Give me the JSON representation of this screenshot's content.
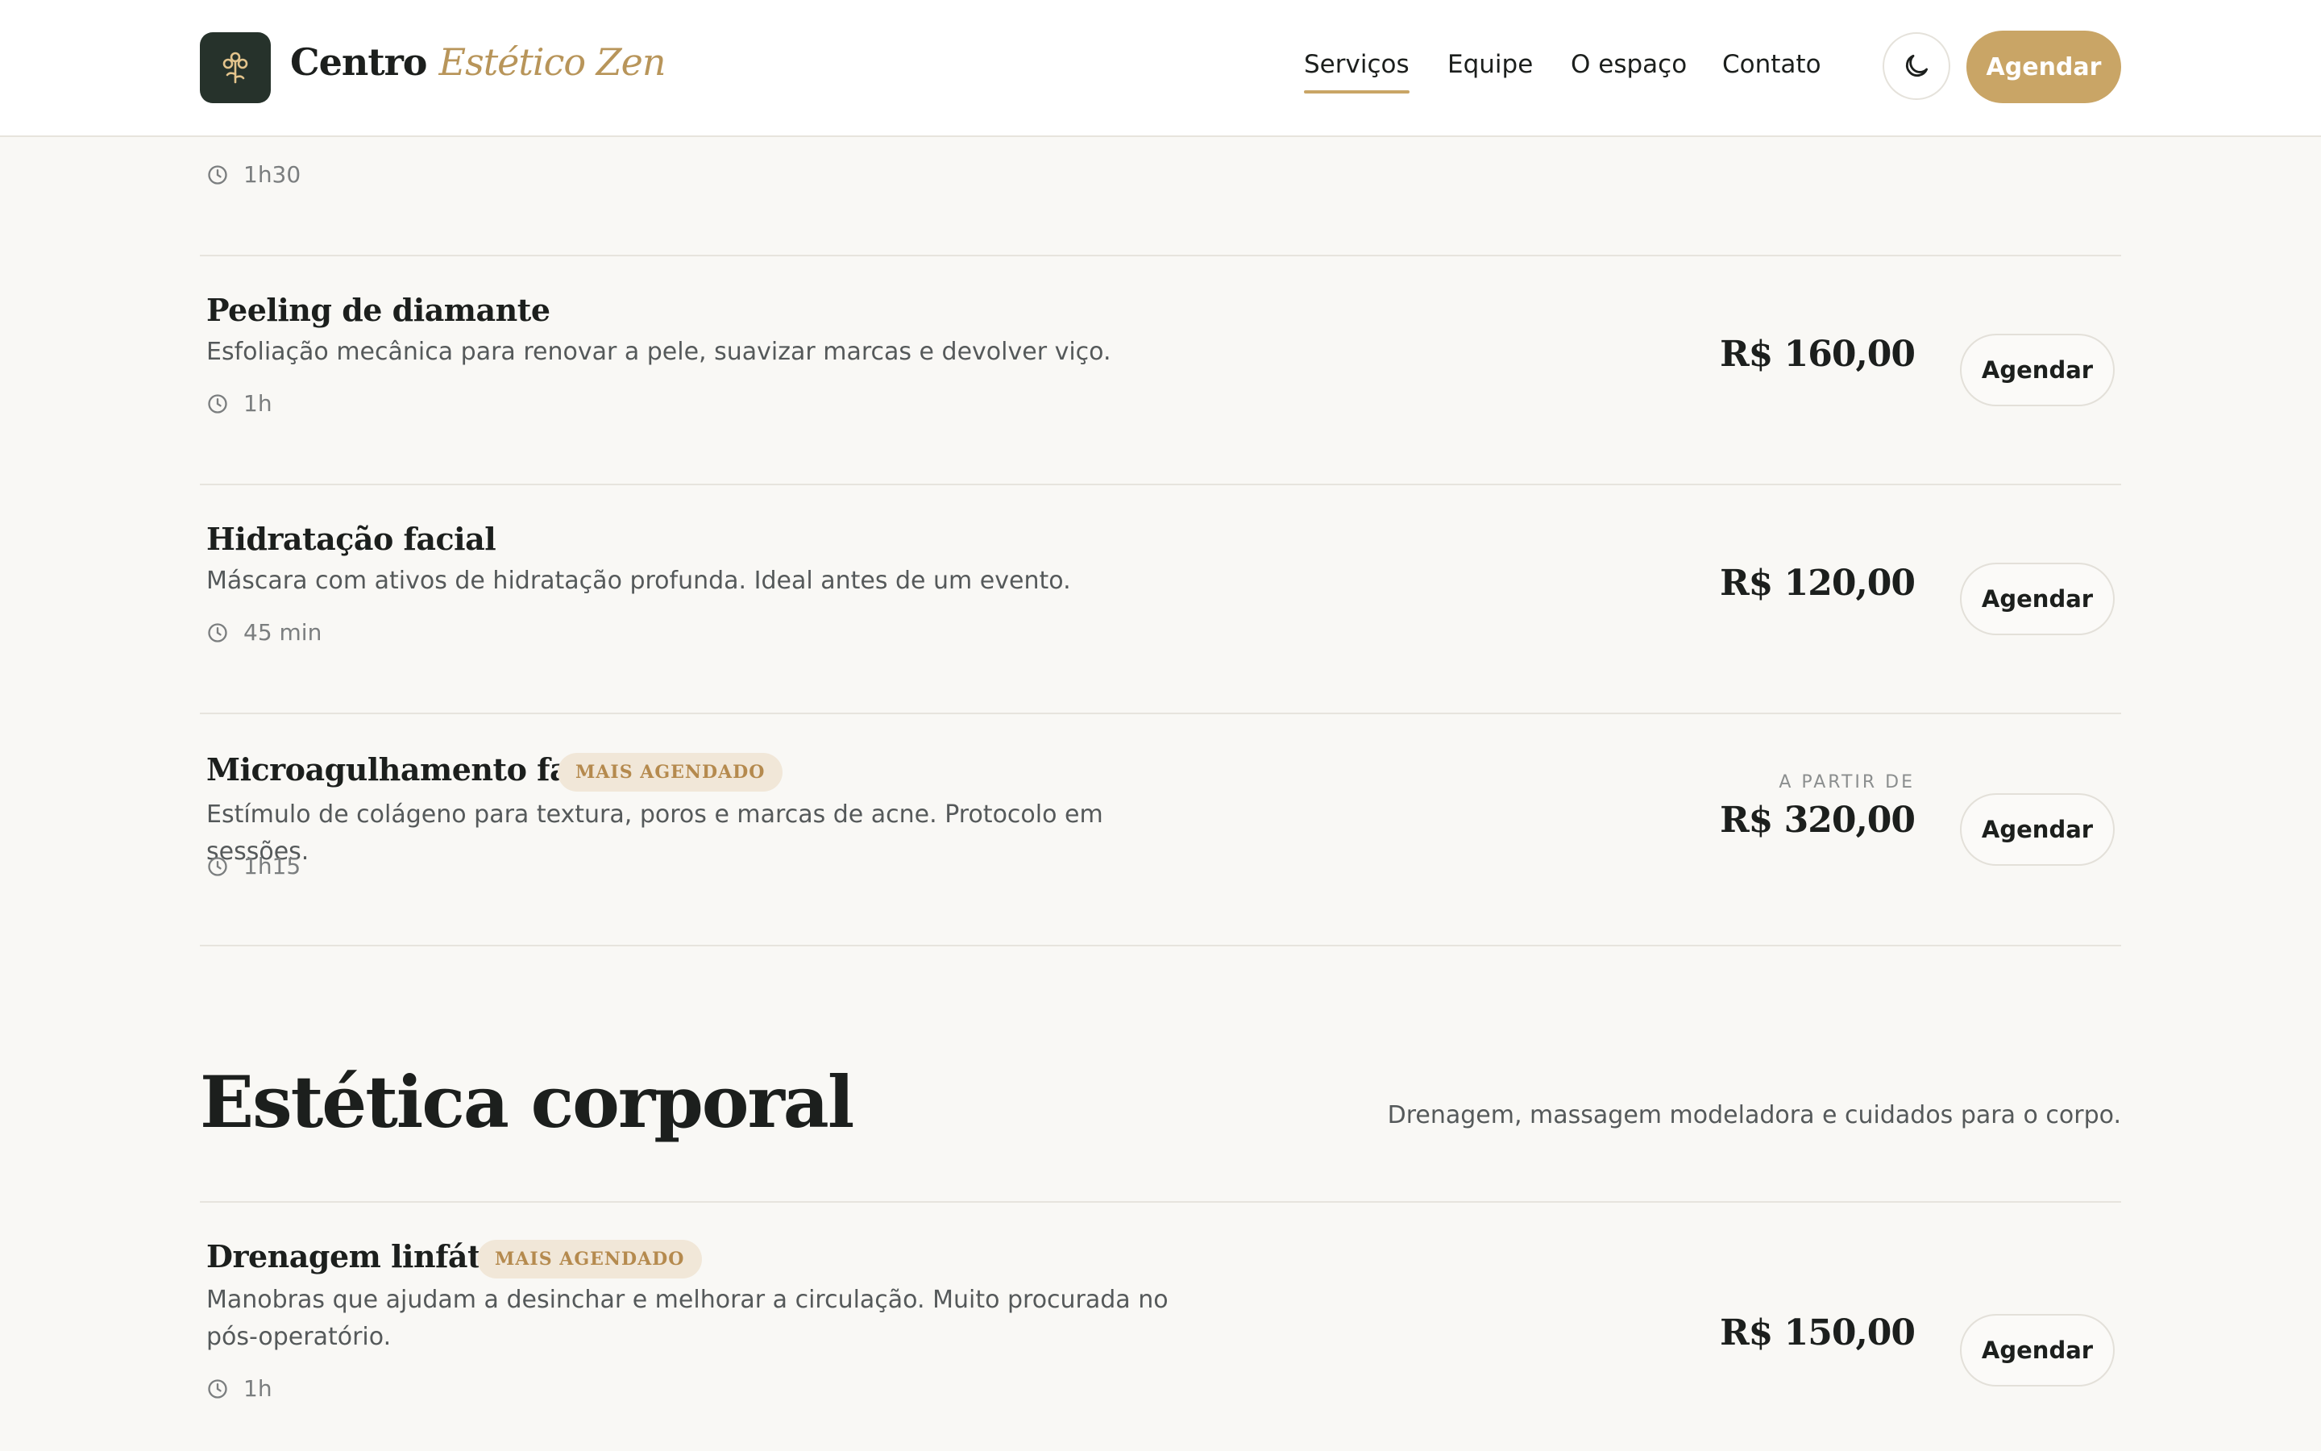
{
  "header": {
    "brand_main": "Centro",
    "brand_accent": "Estético Zen",
    "nav": [
      {
        "label": "Serviços",
        "active": true
      },
      {
        "label": "Equipe"
      },
      {
        "label": "O espaço"
      },
      {
        "label": "Contato"
      }
    ],
    "cta_label": "Agendar",
    "theme_icon": "moon-icon",
    "logo_icon": "flower-icon"
  },
  "partial_row": {
    "duration": "1h30",
    "book_label": "Agendar"
  },
  "services_facial": [
    {
      "name": "Peeling de diamante",
      "description": "Esfoliação mecânica para renovar a pele, suavizar marcas e devolver viço.",
      "duration": "1h",
      "price": "R$ 160,00",
      "book_label": "Agendar"
    },
    {
      "name": "Hidratação facial",
      "description": "Máscara com ativos de hidratação profunda. Ideal antes de um evento.",
      "duration": "45 min",
      "price": "R$ 120,00",
      "book_label": "Agendar"
    },
    {
      "name": "Microagulhamento facial",
      "badge": "MAIS AGENDADO",
      "description": "Estímulo de colágeno para textura, poros e marcas de acne. Protocolo em sessões.",
      "duration": "1h15",
      "price_prefix": "A PARTIR DE",
      "price": "R$ 320,00",
      "book_label": "Agendar"
    }
  ],
  "section_corporal": {
    "title": "Estética corporal",
    "subtitle": "Drenagem, massagem modeladora e cuidados para o corpo."
  },
  "services_corporal": [
    {
      "name": "Drenagem linfática",
      "badge": "MAIS AGENDADO",
      "description": "Manobras que ajudam a desinchar e melhorar a circulação. Muito procurada no pós-operatório.",
      "duration": "1h",
      "price": "R$ 150,00",
      "book_label": "Agendar"
    }
  ],
  "colors": {
    "accent": "#c9a566",
    "brand_dark": "#26322b",
    "badge_bg": "#f1e7d8",
    "badge_text": "#b58a4e",
    "background": "#f9f8f5"
  }
}
